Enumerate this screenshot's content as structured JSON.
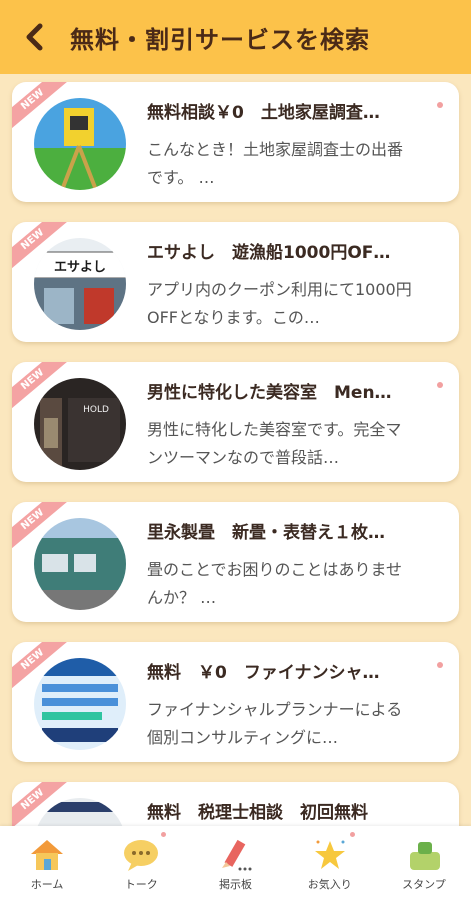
{
  "header": {
    "title": "無料・割引サービスを検索"
  },
  "items": [
    {
      "badge": "NEW",
      "title": "無料相談￥0　土地家屋調査…",
      "desc": "こんなとき！土地家屋調査士の出番です。 …"
    },
    {
      "badge": "NEW",
      "title": "エサよし　遊漁船1000円OF…",
      "desc": "アプリ内のクーポン利用にて1000円OFFとなります。この…",
      "thumb_text": "エサよし"
    },
    {
      "badge": "NEW",
      "title": "男性に特化した美容室　Men…",
      "desc": "男性に特化した美容室です。完全マンツーマンなので普段話…",
      "thumb_text": "HOLD"
    },
    {
      "badge": "NEW",
      "title": "里永製畳　新畳・表替え１枚…",
      "desc": "畳のことでお困りのことはありませんか？ …"
    },
    {
      "badge": "NEW",
      "title": "無料　￥0　ファイナンシャ…",
      "desc": "ファイナンシャルプランナーによる個別コンサルティングに…"
    },
    {
      "badge": "NEW",
      "title": "無料　税理士相談　初回無料",
      "desc": ""
    }
  ],
  "tabs": [
    {
      "label": "ホーム",
      "icon": "home-icon"
    },
    {
      "label": "トーク",
      "icon": "talk-bubble-icon"
    },
    {
      "label": "掲示板",
      "icon": "pencil-icon"
    },
    {
      "label": "お気入り",
      "icon": "star-icon"
    },
    {
      "label": "スタンプ",
      "icon": "stamp-icon"
    }
  ],
  "colors": {
    "header": "#fcc24a",
    "background": "#fbe7be",
    "new_ribbon": "#f4a3a3"
  }
}
